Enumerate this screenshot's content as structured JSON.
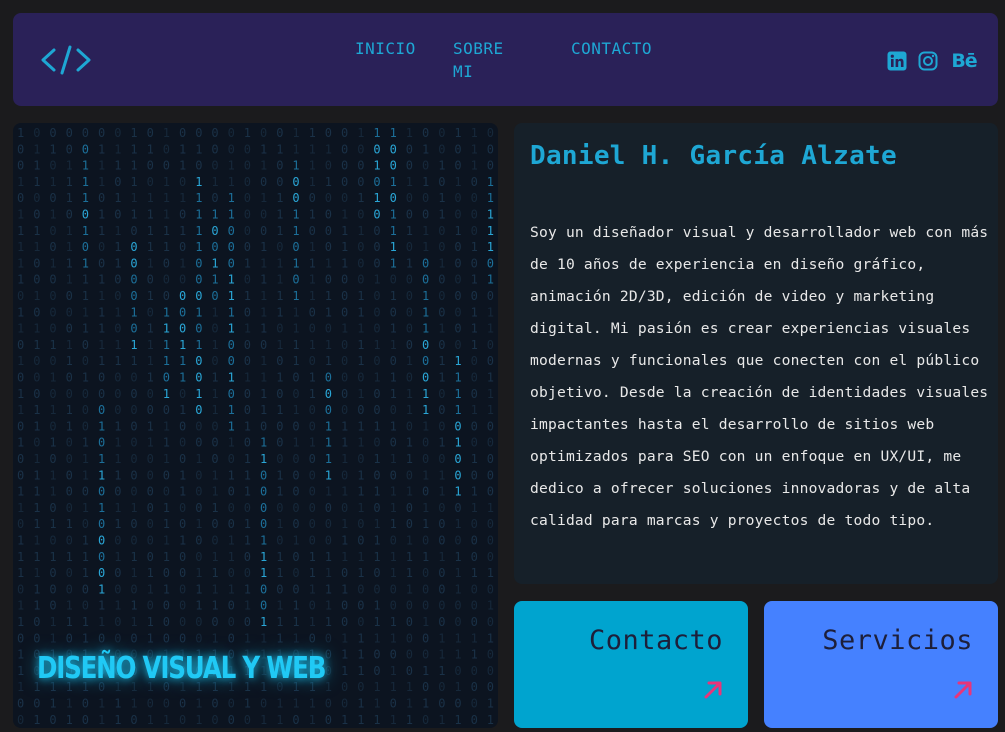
{
  "header": {
    "logo_icon": "code-brackets-icon",
    "nav": [
      {
        "label": "INICIO"
      },
      {
        "label": "SOBRE MI"
      },
      {
        "label": "CONTACTO"
      }
    ],
    "socials": [
      {
        "icon": "linkedin-icon"
      },
      {
        "icon": "instagram-icon"
      },
      {
        "icon": "behance-icon",
        "text": "Bē"
      }
    ]
  },
  "hero": {
    "title": "DISEÑO VISUAL Y WEB",
    "background": "binary-matrix"
  },
  "about": {
    "name": "Daniel H. García Alzate",
    "description": "Soy un diseñador visual y desarrollador web con más de 10 años de experiencia en diseño gráfico, animación 2D/3D, edición de video y marketing digital. Mi pasión es crear experiencias visuales modernas y funcionales que conecten con el público objetivo. Desde la creación de identidades visuales impactantes hasta el desarrollo de sitios web optimizados para SEO con un enfoque en UX/UI, me dedico a ofrecer soluciones innovadoras y de alta calidad para marcas y proyectos de todo tipo."
  },
  "cards": {
    "contacto": {
      "label": "Contacto",
      "icon": "arrow-up-right-icon"
    },
    "servicios": {
      "label": "Servicios",
      "icon": "arrow-up-right-icon"
    }
  },
  "colors": {
    "background": "#1b1b1d",
    "header": "#2a2158",
    "accent": "#1ea7d4",
    "card_contacto": "#00a4cf",
    "card_servicios": "#4581ff",
    "arrow": "#e8357a"
  }
}
